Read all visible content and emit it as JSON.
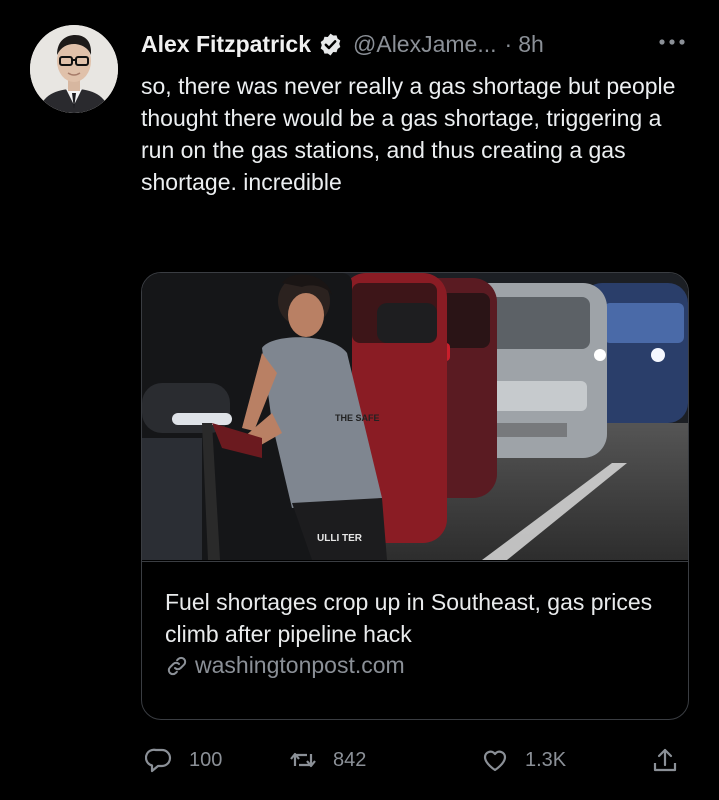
{
  "tweet": {
    "author_name": "Alex Fitzpatrick",
    "author_handle": "@AlexJame...",
    "separator": "·",
    "timestamp": "8h",
    "verified": true,
    "text": "so, there was never really a gas shortage but people thought there would be a gas shortage, triggering a run on the gas stations, and thus creating a gas shortage. incredible",
    "more_icon": "more-horizontal-icon"
  },
  "link_card": {
    "title": "Fuel shortages crop up in Southeast, gas prices climb after pipeline hack",
    "domain": "washingtonpost.com",
    "image_alt_text_visible_on_shirt": "THE SAFE",
    "image_text_on_pants": "ULLI TER"
  },
  "actions": {
    "reply_count": "100",
    "retweet_count": "842",
    "like_count": "1.3K",
    "icons": [
      "reply-icon",
      "retweet-icon",
      "like-icon",
      "share-icon"
    ]
  },
  "colors": {
    "background": "#000000",
    "text": "#e7e9ea",
    "secondary": "#8b9097",
    "border": "#3a3d42",
    "verified_badge": "#e7e9ea"
  }
}
